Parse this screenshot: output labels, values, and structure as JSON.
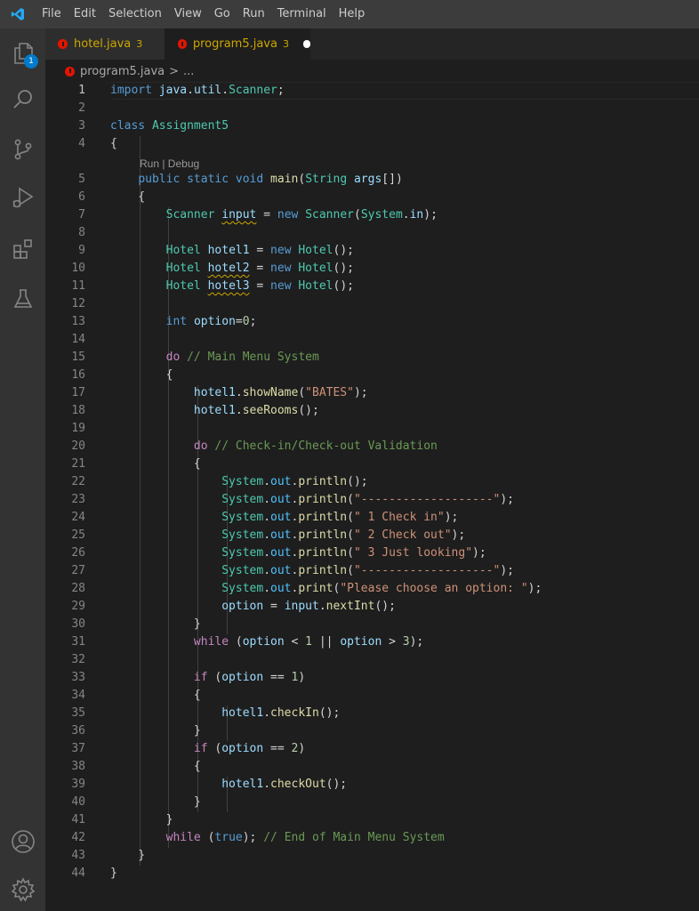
{
  "menu": {
    "items": [
      "File",
      "Edit",
      "Selection",
      "View",
      "Go",
      "Run",
      "Terminal",
      "Help"
    ]
  },
  "activity_bar": {
    "explorer_badge": "1",
    "icons": [
      "files-icon",
      "search-icon",
      "source-control-icon",
      "run-debug-icon",
      "extensions-icon",
      "testing-icon",
      "account-icon",
      "gear-icon"
    ]
  },
  "tabs": [
    {
      "name": "hotel.java",
      "problems": "3",
      "active": false
    },
    {
      "name": "program5.java",
      "problems": "3",
      "active": true,
      "modified": true
    }
  ],
  "breadcrumb": {
    "file": "program5.java",
    "separator": ">",
    "rest": "..."
  },
  "editor": {
    "codelens": "Run | Debug",
    "lines": [
      {
        "n": "1",
        "t": "import java.util.Scanner;"
      },
      {
        "n": "2",
        "t": ""
      },
      {
        "n": "3",
        "t": "class Assignment5"
      },
      {
        "n": "4",
        "t": "{"
      },
      {
        "n": "5",
        "t": "    public static void main(String args[])"
      },
      {
        "n": "6",
        "t": "    {"
      },
      {
        "n": "7",
        "t": "        Scanner input = new Scanner(System.in);"
      },
      {
        "n": "8",
        "t": ""
      },
      {
        "n": "9",
        "t": "        Hotel hotel1 = new Hotel();"
      },
      {
        "n": "10",
        "t": "        Hotel hotel2 = new Hotel();"
      },
      {
        "n": "11",
        "t": "        Hotel hotel3 = new Hotel();"
      },
      {
        "n": "12",
        "t": ""
      },
      {
        "n": "13",
        "t": "        int option=0;"
      },
      {
        "n": "14",
        "t": ""
      },
      {
        "n": "15",
        "t": "        do // Main Menu System"
      },
      {
        "n": "16",
        "t": "        {"
      },
      {
        "n": "17",
        "t": "            hotel1.showName(\"BATES\");"
      },
      {
        "n": "18",
        "t": "            hotel1.seeRooms();"
      },
      {
        "n": "19",
        "t": ""
      },
      {
        "n": "20",
        "t": "            do // Check-in/Check-out Validation"
      },
      {
        "n": "21",
        "t": "            {"
      },
      {
        "n": "22",
        "t": "                System.out.println();"
      },
      {
        "n": "23",
        "t": "                System.out.println(\"-------------------\");"
      },
      {
        "n": "24",
        "t": "                System.out.println(\" 1 Check in\");"
      },
      {
        "n": "25",
        "t": "                System.out.println(\" 2 Check out\");"
      },
      {
        "n": "26",
        "t": "                System.out.println(\" 3 Just looking\");"
      },
      {
        "n": "27",
        "t": "                System.out.println(\"-------------------\");"
      },
      {
        "n": "28",
        "t": "                System.out.print(\"Please choose an option: \");"
      },
      {
        "n": "29",
        "t": "                option = input.nextInt();"
      },
      {
        "n": "30",
        "t": "            }"
      },
      {
        "n": "31",
        "t": "            while (option < 1 || option > 3);"
      },
      {
        "n": "32",
        "t": ""
      },
      {
        "n": "33",
        "t": "            if (option == 1)"
      },
      {
        "n": "34",
        "t": "            {"
      },
      {
        "n": "35",
        "t": "                hotel1.checkIn();"
      },
      {
        "n": "36",
        "t": "            }"
      },
      {
        "n": "37",
        "t": "            if (option == 2)"
      },
      {
        "n": "38",
        "t": "            {"
      },
      {
        "n": "39",
        "t": "                hotel1.checkOut();"
      },
      {
        "n": "40",
        "t": "            }"
      },
      {
        "n": "41",
        "t": "        }"
      },
      {
        "n": "42",
        "t": "        while (true); // End of Main Menu System"
      },
      {
        "n": "43",
        "t": "    }"
      },
      {
        "n": "44",
        "t": "}"
      }
    ]
  }
}
